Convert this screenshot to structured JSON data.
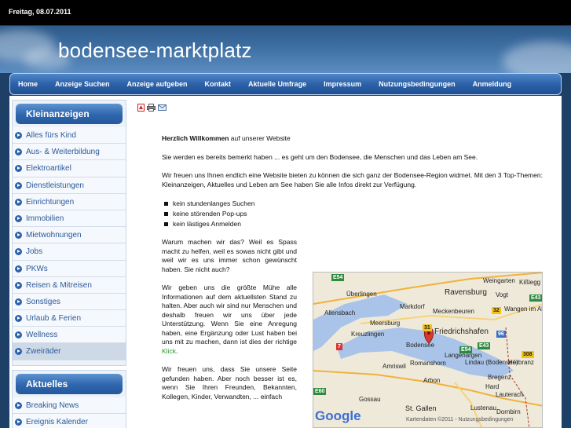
{
  "topbar": {
    "date": "Freitag, 08.07.2011"
  },
  "header": {
    "site_title": "bodensee-marktplatz"
  },
  "nav": [
    "Home",
    "Anzeige Suchen",
    "Anzeige aufgeben",
    "Kontakt",
    "Aktuelle Umfrage",
    "Impressum",
    "Nutzungsbedingungen",
    "Anmeldung"
  ],
  "sidebar": {
    "kleinanzeigen_title": "Kleinanzeigen",
    "kleinanzeigen_items": [
      "Alles fürs Kind",
      "Aus- & Weiterbildung",
      "Elektroartikel",
      "Dienstleistungen",
      "Einrichtungen",
      "Immobilien",
      "Mietwohnungen",
      "Jobs",
      "PKWs",
      "Reisen & Mitreisen",
      "Sonstiges",
      "Urlaub & Ferien",
      "Wellness",
      "Zweiräder"
    ],
    "aktuelles_title": "Aktuelles",
    "aktuelles_items": [
      "Breaking News",
      "Ereignis Kalender"
    ]
  },
  "toolbar_icons": [
    "pdf-icon",
    "print-icon",
    "email-icon"
  ],
  "content": {
    "welcome_bold": "Herzlich Willkommen",
    "welcome_rest": " auf unserer Website",
    "p1": "Sie werden es bereits bemerkt haben ... es geht um den Bodensee, die Menschen und das Leben am See.",
    "p2": "Wir freuen uns Ihnen endlich eine Website bieten zu können die sich ganz der Bodensee-Region widmet. Mit den 3 Top-Themen: Kleinanzeigen, Aktuelles und Leben am See haben Sie alle Infos direkt zur Verfügung.",
    "bullets": [
      "kein stundenlanges Suchen",
      "keine störenden Pop-ups",
      "kein lästiges Anmelden"
    ],
    "p3": "Warum machen wir das? Weil es Spass macht zu helfen, weil es sowas nicht gibt und weil wir es uns immer schon gewünscht haben. Sie nicht auch?",
    "p4": "Wir geben uns die größte Mühe alle Informationen auf dem aktuellsten Stand zu halten. Aber auch wir sind nur Menschen und deshalb freuen wir uns über jede Unterstützung. Wenn Sie eine Anregung haben, eine Ergänzung oder Lust haben bei uns mit zu machen, dann ist dies der richtige ",
    "p4_link": "Klick",
    "p4_end": ".",
    "p5": "Wir freuen uns, dass Sie unsere Seite gefunden haben. Aber noch besser ist es, wenn Sie Ihren Freunden, Bekannten, Kollegen, Kinder, Verwandten, ... einfach"
  },
  "map": {
    "places": [
      "Weingarten",
      "Kißlegg",
      "Ravensburg",
      "Vogt",
      "Überlingen",
      "Markdorf",
      "Meckenbeuren",
      "Wangen im Allgäu",
      "Allensbach",
      "Meersburg",
      "Friedrichshafen",
      "Kreuzlingen",
      "Bodensee",
      "Lindau (Bodensee)",
      "Romanshorn",
      "Hörbranz",
      "Amriswil",
      "Bregenz",
      "Arbon",
      "Lauterach",
      "Gossau",
      "St. Gallen",
      "Lustenau",
      "Dornbirn",
      "Hard",
      "Langenargen"
    ],
    "roads": [
      "E54",
      "E43",
      "31",
      "32",
      "7",
      "96",
      "E54",
      "308",
      "E60",
      "E43"
    ],
    "copyright": "Kartendaten ©2011 - Nutzungsbedingungen",
    "brand": "Google"
  },
  "colors": {
    "nav": "#2d62a8",
    "sidebar_head": "#2e66ad",
    "link": "#2b5a9a",
    "klick": "#2a9a2a"
  }
}
